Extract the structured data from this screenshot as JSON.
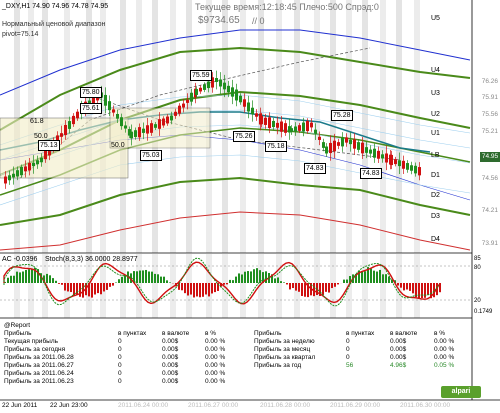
{
  "window": {
    "symbol_line": "_DXY,H1  74.90 74.96 74.78 74.95",
    "indicator_title": "Нормальный ценовой диапазон",
    "pivot_label": "pivot=75.14",
    "status_line": "Текущее время:12:18:45 Плечо:500 Спрэд:0",
    "balance_line": "$9734.65",
    "balance_suffix": "// 0"
  },
  "price_axis": {
    "ticks": [
      "76.26",
      "75.91",
      "75.56",
      "75.21",
      "74.95",
      "74.56",
      "74.21",
      "73.91"
    ],
    "current_price": "74.95"
  },
  "pivot_levels": [
    "U5",
    "U4",
    "U3",
    "U2",
    "U1",
    "LB",
    "D1",
    "D2",
    "D3",
    "D4"
  ],
  "chart_boxes": [
    "75.80",
    "75.59",
    "75.61",
    "75.13",
    "75.03",
    "75.26",
    "75.28",
    "75.18",
    "74.83",
    "74.83"
  ],
  "fib_labels": [
    "61.8",
    "50.0",
    "50.0"
  ],
  "ac_indicator": {
    "title": "AC -0.0396",
    "stoch_title": "Stoch(8,3,3) 36.0000 28.8977",
    "scale": [
      "80",
      "20",
      "0.1749",
      "85"
    ]
  },
  "report": {
    "header": "@Report",
    "left_headers": [
      "в пунктах",
      "в валюте",
      "в %"
    ],
    "right_headers": [
      "в пунктах",
      "в валюте",
      "в %"
    ],
    "left_rows": [
      {
        "label": "Прибыль",
        "points": "",
        "money": "",
        "pct": ""
      },
      {
        "label": "Текущая прибыль",
        "points": "0",
        "money": "0.00$",
        "pct": "0.00 %"
      },
      {
        "label": "Прибыль за сегодня",
        "points": "0",
        "money": "0.00$",
        "pct": "0.00 %"
      },
      {
        "label": "Прибыль за 2011.06.28",
        "points": "0",
        "money": "0.00$",
        "pct": "0.00 %"
      },
      {
        "label": "Прибыль за 2011.06.27",
        "points": "0",
        "money": "0.00$",
        "pct": "0.00 %"
      },
      {
        "label": "Прибыль за 2011.06.24",
        "points": "0",
        "money": "0.00$",
        "pct": "0.00 %"
      },
      {
        "label": "Прибыль за 2011.06.23",
        "points": "0",
        "money": "0.00$",
        "pct": "0.00 %"
      }
    ],
    "right_rows": [
      {
        "label": "Прибыль",
        "points": "",
        "money": "",
        "pct": ""
      },
      {
        "label": "Прибыль за неделю",
        "points": "0",
        "money": "0.00$",
        "pct": "0.00 %"
      },
      {
        "label": "Прибыль за месяц",
        "points": "0",
        "money": "0.00$",
        "pct": "0.00 %"
      },
      {
        "label": "Прибыль за квартал",
        "points": "0",
        "money": "0.00$",
        "pct": "0.00 %"
      },
      {
        "label": "Прибыль за год",
        "points": "56",
        "money": "4.96$",
        "pct": "0.05 %"
      }
    ]
  },
  "x_axis": [
    "22 Jun 2011",
    "22 Jun 23:00",
    "2011.06.24 00:00",
    "2011.06.27 00:00",
    "2011.06.28 00:00",
    "2011.06.29 00:00",
    "2011.06.30 00:00"
  ],
  "brand": "alpari",
  "colors": {
    "bull": "#1f8f1f",
    "bear": "#d01010",
    "band_green": "#4a8a1a",
    "band_blue": "#2030d0",
    "band_red": "#d03030",
    "light_blue": "#9fd0ef"
  }
}
